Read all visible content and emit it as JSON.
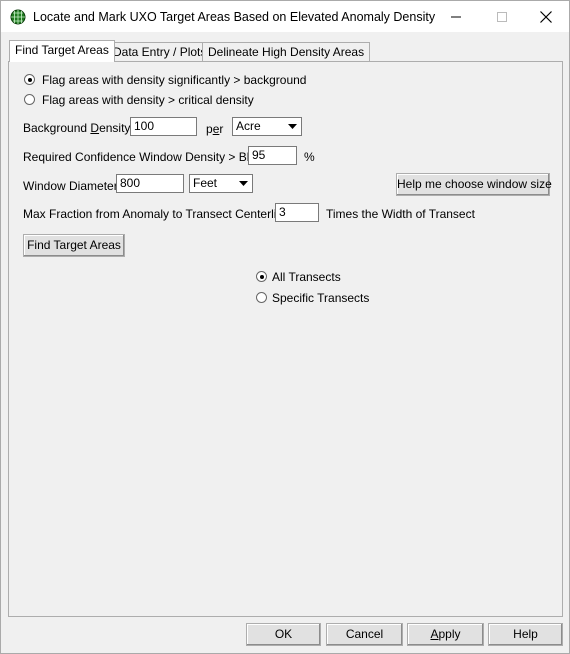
{
  "window": {
    "title": "Locate and Mark UXO Target Areas Based on Elevated Anomaly Density"
  },
  "tabs": [
    {
      "label": "Find Target Areas"
    },
    {
      "label": "Data Entry / Plots"
    },
    {
      "label": "Delineate High Density Areas"
    }
  ],
  "flag_options": [
    {
      "label": "Flag areas with density significantly > background",
      "checked": true
    },
    {
      "label": "Flag areas with density > critical density",
      "checked": false
    }
  ],
  "background_density": {
    "label_pre": "Background ",
    "label_ul": "D",
    "label_post": "ensity:",
    "value": "100",
    "per_pre": "p",
    "per_ul": "e",
    "per_post": "r",
    "unit": "Acre"
  },
  "confidence": {
    "label": "Required Confidence Window Density > Bkg:",
    "value": "95",
    "suffix": "%"
  },
  "window_diameter": {
    "label": "Window Diameter:",
    "value": "800",
    "unit": "Feet",
    "help_button": "Help me choose window size"
  },
  "max_fraction": {
    "label": "Max Fraction from Anomaly to Transect Centerline:",
    "value": "3",
    "suffix": "Times the Width of Transect"
  },
  "find_button": "Find Target Areas",
  "transect_options": [
    {
      "label": "All Transects",
      "checked": true
    },
    {
      "label": "Specific Transects",
      "checked": false
    }
  ],
  "footer": {
    "ok": "OK",
    "cancel": "Cancel",
    "apply_ul": "A",
    "apply_rest": "pply",
    "help": "Help"
  }
}
